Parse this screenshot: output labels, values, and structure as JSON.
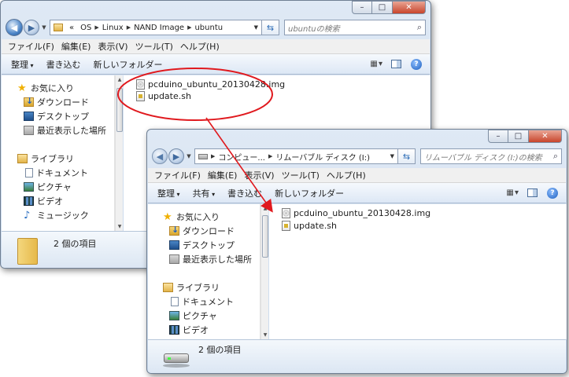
{
  "window1": {
    "caption": {
      "minimize": "–",
      "maximize": "□",
      "close": "✕"
    },
    "address": {
      "overflow": "«",
      "segments": [
        "OS",
        "Linux",
        "NAND Image",
        "ubuntu"
      ]
    },
    "search": {
      "placeholder": "ubuntuの検索"
    },
    "menu": [
      "ファイル(F)",
      "編集(E)",
      "表示(V)",
      "ツール(T)",
      "ヘルプ(H)"
    ],
    "toolbar": {
      "organize": "整理",
      "burn": "書き込む",
      "new_folder": "新しいフォルダー"
    },
    "nav": {
      "favorites": "お気に入り",
      "downloads": "ダウンロード",
      "desktop": "デスクトップ",
      "recent": "最近表示した場所",
      "libraries": "ライブラリ",
      "documents": "ドキュメント",
      "pictures": "ピクチャ",
      "videos": "ビデオ",
      "music": "ミュージック"
    },
    "files": [
      "pcduino_ubuntu_20130428.img",
      "update.sh"
    ],
    "status": "2 個の項目"
  },
  "window2": {
    "caption": {
      "minimize": "–",
      "maximize": "□",
      "close": "✕"
    },
    "address": {
      "segments": [
        "コンピュー...",
        "リムーバブル ディスク (I:)"
      ]
    },
    "search": {
      "placeholder": "リムーバブル ディスク (I:)の検索"
    },
    "menu": [
      "ファイル(F)",
      "編集(E)",
      "表示(V)",
      "ツール(T)",
      "ヘルプ(H)"
    ],
    "toolbar": {
      "organize": "整理",
      "share": "共有",
      "burn": "書き込む",
      "new_folder": "新しいフォルダー"
    },
    "nav": {
      "favorites": "お気に入り",
      "downloads": "ダウンロード",
      "desktop": "デスクトップ",
      "recent": "最近表示した場所",
      "libraries": "ライブラリ",
      "documents": "ドキュメント",
      "pictures": "ピクチャ",
      "videos": "ビデオ"
    },
    "files": [
      "pcduino_ubuntu_20130428.img",
      "update.sh"
    ],
    "status": "2 個の項目"
  },
  "annotation": {
    "color": "#e0191e"
  }
}
